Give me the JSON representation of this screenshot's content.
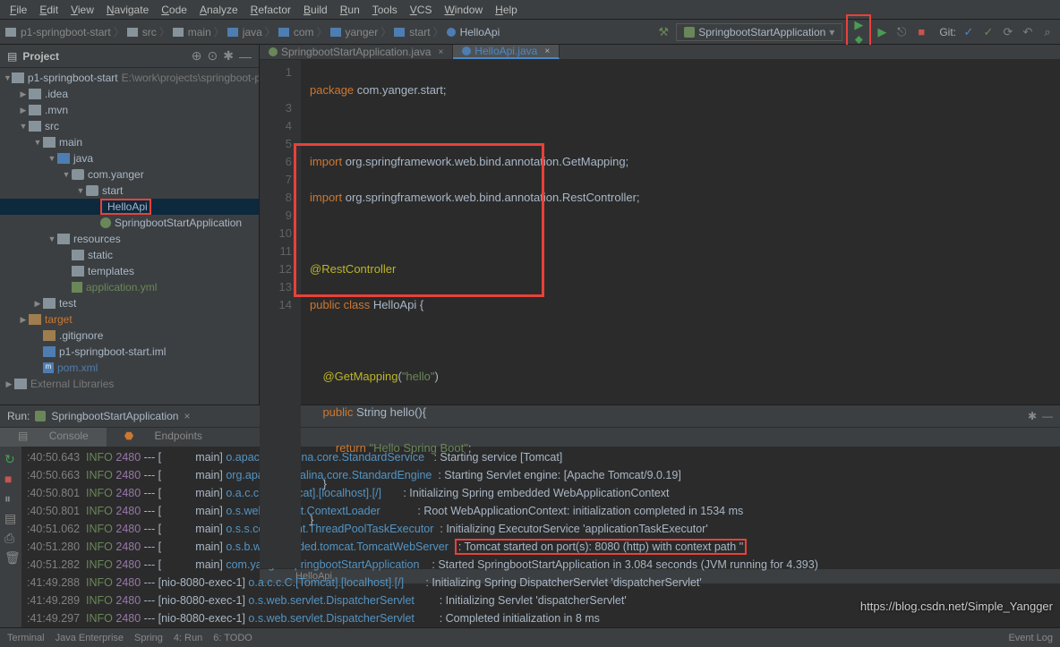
{
  "menu": [
    "File",
    "Edit",
    "View",
    "Navigate",
    "Code",
    "Analyze",
    "Refactor",
    "Build",
    "Run",
    "Tools",
    "VCS",
    "Window",
    "Help"
  ],
  "breadcrumb": {
    "items": [
      "p1-springboot-start",
      "src",
      "main",
      "java",
      "com",
      "yanger",
      "start"
    ],
    "class": "HelloApi"
  },
  "run_config": "SpringbootStartApplication",
  "git_label": "Git:",
  "project": {
    "title": "Project",
    "root": "p1-springboot-start",
    "root_path": "E:\\work\\projects\\springboot-p...",
    "idea": ".idea",
    "mvn": ".mvn",
    "src": "src",
    "main": "main",
    "java": "java",
    "pkg": "com.yanger",
    "start": "start",
    "helloapi": "HelloApi",
    "sbapp": "SpringbootStartApplication",
    "resources": "resources",
    "static": "static",
    "templates": "templates",
    "appyml": "application.yml",
    "test": "test",
    "target": "target",
    "gitignore": ".gitignore",
    "iml": "p1-springboot-start.iml",
    "pom": "pom.xml",
    "ext_lib": "External Libraries"
  },
  "tabs": [
    {
      "name": "SpringbootStartApplication.java"
    },
    {
      "name": "HelloApi.java"
    }
  ],
  "code": {
    "l1_a": "package",
    "l1_b": " com.yanger.start;",
    "l3_a": "import",
    "l3_b": " org.springframework.web.bind.annotation.GetMapping;",
    "l4_a": "import",
    "l4_b": " org.springframework.web.bind.annotation.RestController;",
    "l6": "@RestController",
    "l7_a": "public class ",
    "l7_b": "HelloApi {",
    "l9_a": "    @GetMapping",
    "l9_b": "(",
    "l9_c": "\"hello\"",
    "l9_d": ")",
    "l10_a": "    public ",
    "l10_b": "String ",
    "l10_c": "hello(){",
    "l11_a": "        return ",
    "l11_b": "\"Hello Spring Boot\"",
    "l11_c": ";",
    "l12": "    }",
    "l13": "}"
  },
  "bc_bottom": "HelloApi",
  "run_tab": {
    "label": "Run:",
    "name": "SpringbootStartApplication"
  },
  "inner_tabs": [
    "Console",
    "Endpoints"
  ],
  "log": [
    {
      "ts": ":40:50.643",
      "lvl": "INFO",
      "pid": "2480",
      "thr": "--- [           main]",
      "cls": "o.apache.catalina.core.StandardService",
      "msg": ": Starting service [Tomcat]"
    },
    {
      "ts": ":40:50.663",
      "lvl": "INFO",
      "pid": "2480",
      "thr": "--- [           main]",
      "cls": "org.apache.catalina.core.StandardEngine",
      "msg": ": Starting Servlet engine: [Apache Tomcat/9.0.19]"
    },
    {
      "ts": ":40:50.801",
      "lvl": "INFO",
      "pid": "2480",
      "thr": "--- [           main]",
      "cls": "o.a.c.c.C.[Tomcat].[localhost].[/]",
      "msg": ": Initializing Spring embedded WebApplicationContext"
    },
    {
      "ts": ":40:50.801",
      "lvl": "INFO",
      "pid": "2480",
      "thr": "--- [           main]",
      "cls": "o.s.web.context.ContextLoader",
      "msg": ": Root WebApplicationContext: initialization completed in 1534 ms"
    },
    {
      "ts": ":40:51.062",
      "lvl": "INFO",
      "pid": "2480",
      "thr": "--- [           main]",
      "cls": "o.s.s.concurrent.ThreadPoolTaskExecutor",
      "msg": ": Initializing ExecutorService 'applicationTaskExecutor'"
    },
    {
      "ts": ":40:51.280",
      "lvl": "INFO",
      "pid": "2480",
      "thr": "--- [           main]",
      "cls": "o.s.b.w.embedded.tomcat.TomcatWebServer",
      "msg": ": Tomcat started on port(s): 8080 (http) with context path ''",
      "hl": true
    },
    {
      "ts": ":40:51.282",
      "lvl": "INFO",
      "pid": "2480",
      "thr": "--- [           main]",
      "cls": "com.yanger.SpringbootStartApplication",
      "msg": ": Started SpringbootStartApplication in 3.084 seconds (JVM running for 4.393)"
    },
    {
      "ts": ":41:49.288",
      "lvl": "INFO",
      "pid": "2480",
      "thr": "--- [nio-8080-exec-1]",
      "cls": "o.a.c.c.C.[Tomcat].[localhost].[/]",
      "msg": ": Initializing Spring DispatcherServlet 'dispatcherServlet'"
    },
    {
      "ts": ":41:49.289",
      "lvl": "INFO",
      "pid": "2480",
      "thr": "--- [nio-8080-exec-1]",
      "cls": "o.s.web.servlet.DispatcherServlet",
      "msg": ": Initializing Servlet 'dispatcherServlet'"
    },
    {
      "ts": ":41:49.297",
      "lvl": "INFO",
      "pid": "2480",
      "thr": "--- [nio-8080-exec-1]",
      "cls": "o.s.web.servlet.DispatcherServlet",
      "msg": ": Completed initialization in 8 ms"
    }
  ],
  "status": {
    "left": [
      "Terminal",
      "Java Enterprise",
      "Spring",
      "4: Run",
      "6: TODO"
    ],
    "right": "Event Log"
  },
  "watermark": "https://blog.csdn.net/Simple_Yangger"
}
